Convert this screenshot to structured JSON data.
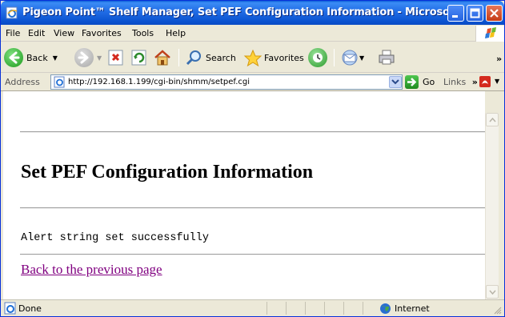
{
  "window": {
    "title": "Pigeon Point™ Shelf Manager, Set PEF Configuration Information - Microso...",
    "icons": [
      "ie-page-icon",
      "minimize-icon",
      "maximize-icon",
      "close-icon"
    ]
  },
  "menubar": {
    "items": [
      {
        "label": "File"
      },
      {
        "label": "Edit"
      },
      {
        "label": "View"
      },
      {
        "label": "Favorites"
      },
      {
        "label": "Tools"
      },
      {
        "label": "Help"
      }
    ]
  },
  "toolbar": {
    "back_label": "Back",
    "search_label": "Search",
    "favorites_label": "Favorites",
    "overflow": "»"
  },
  "address": {
    "label": "Address",
    "url": "http://192.168.1.199/cgi-bin/shmm/setpef.cgi",
    "go_label": "Go",
    "links_label": "Links",
    "links_overflow": "»"
  },
  "page": {
    "heading": "Set PEF Configuration Information",
    "message": "Alert string set successfully",
    "back_link": "Back to the previous page"
  },
  "status": {
    "text": "Done",
    "zone": "Internet"
  },
  "colors": {
    "titlebar": "#2470e8",
    "link_visited": "#800080",
    "chrome": "#ece9d8"
  }
}
